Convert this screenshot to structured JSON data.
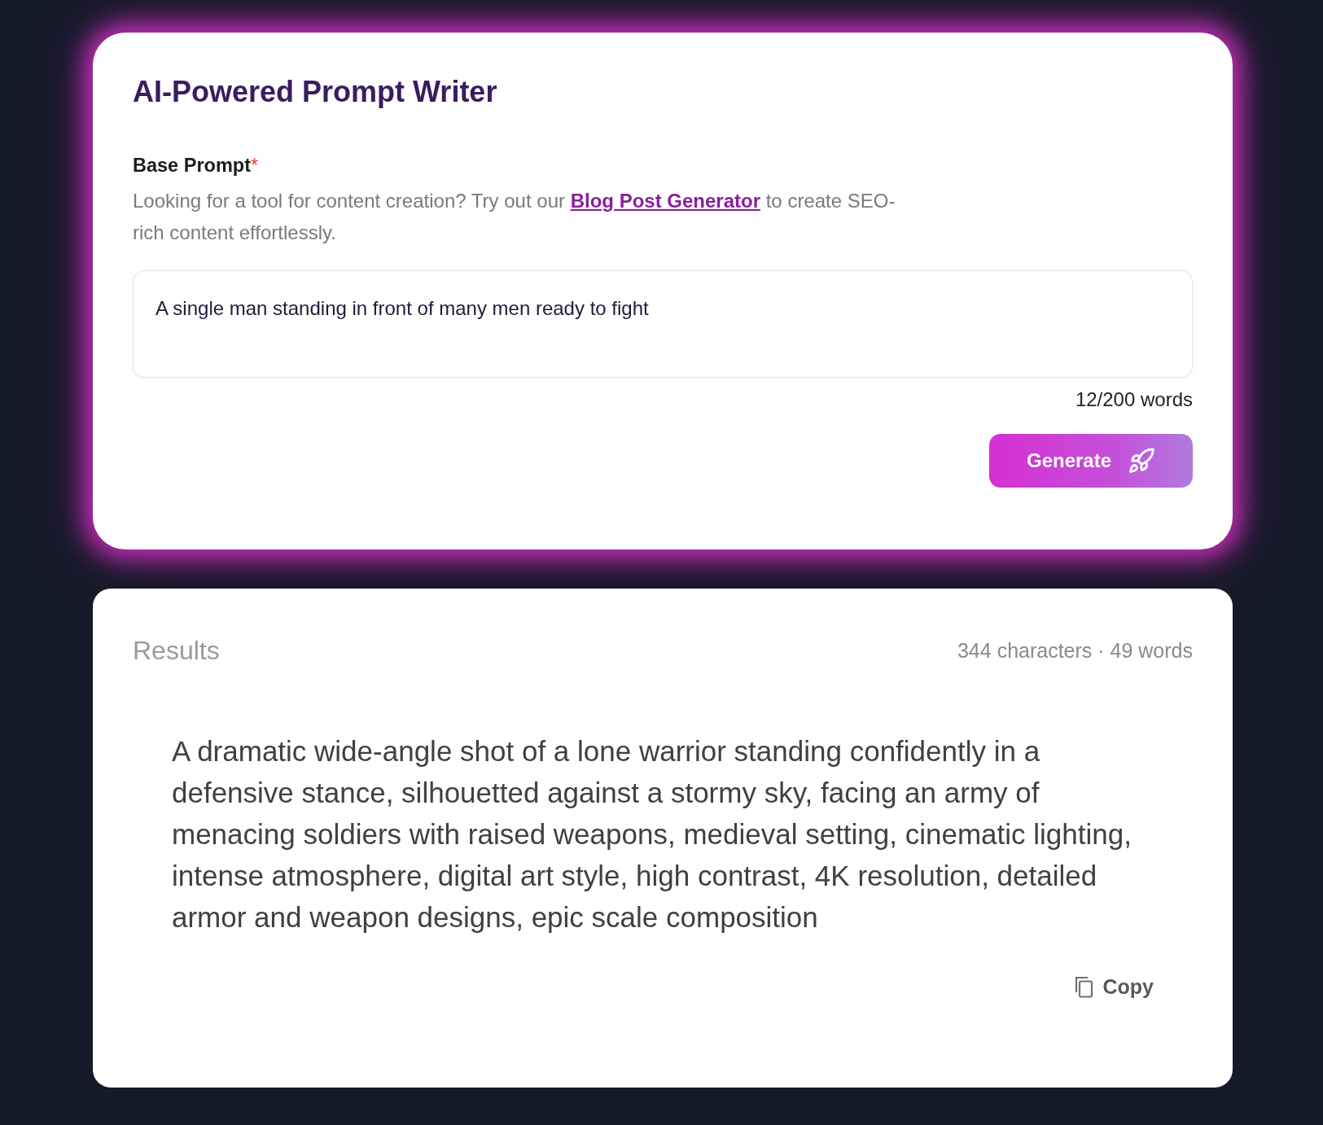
{
  "prompt_card": {
    "title": "AI-Powered Prompt Writer",
    "label": "Base Prompt",
    "required_mark": "*",
    "helper_before": "Looking for a tool for content creation? Try out our ",
    "helper_link": "Blog Post Generator",
    "helper_after": " to create SEO-rich content effortlessly.",
    "prompt_value": "A single man standing in front of many men ready to fight",
    "word_count": "12/200 words",
    "generate_button": "Generate"
  },
  "results_card": {
    "title": "Results",
    "stats": "344 characters · 49 words",
    "result_text": "A dramatic wide-angle shot of a lone warrior standing confidently in a defensive stance, silhouetted against a stormy sky, facing an army of menacing soldiers with raised weapons, medieval setting, cinematic lighting, intense atmosphere, digital art style, high contrast, 4K resolution, detailed armor and weapon designs, epic scale composition",
    "copy_button": "Copy"
  }
}
